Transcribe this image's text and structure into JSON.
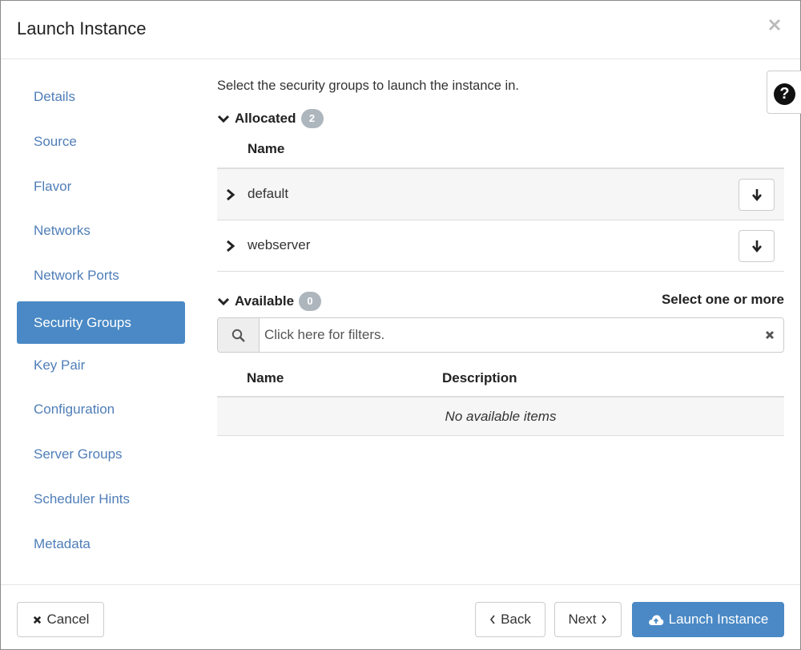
{
  "dialog": {
    "title": "Launch Instance"
  },
  "sidebar": {
    "items": [
      {
        "label": "Details"
      },
      {
        "label": "Source"
      },
      {
        "label": "Flavor"
      },
      {
        "label": "Networks"
      },
      {
        "label": "Network Ports"
      },
      {
        "label": "Security Groups",
        "active": true
      },
      {
        "label": "Key Pair"
      },
      {
        "label": "Configuration"
      },
      {
        "label": "Server Groups"
      },
      {
        "label": "Scheduler Hints"
      },
      {
        "label": "Metadata"
      }
    ]
  },
  "main": {
    "intro": "Select the security groups to launch the instance in.",
    "help_icon": "question-circle-icon",
    "allocated": {
      "label": "Allocated",
      "count": "2",
      "column_name": "Name",
      "rows": [
        {
          "name": "default"
        },
        {
          "name": "webserver"
        }
      ]
    },
    "available": {
      "label": "Available",
      "count": "0",
      "select_hint": "Select one or more",
      "filter_placeholder": "Click here for filters.",
      "columns": {
        "name": "Name",
        "description": "Description"
      },
      "empty_message": "No available items"
    }
  },
  "footer": {
    "cancel_label": "Cancel",
    "back_label": "Back",
    "next_label": "Next",
    "launch_label": "Launch Instance"
  },
  "colors": {
    "accent": "#4a89c5",
    "link": "#4f7eb8",
    "badge": "#aeb6bd"
  }
}
